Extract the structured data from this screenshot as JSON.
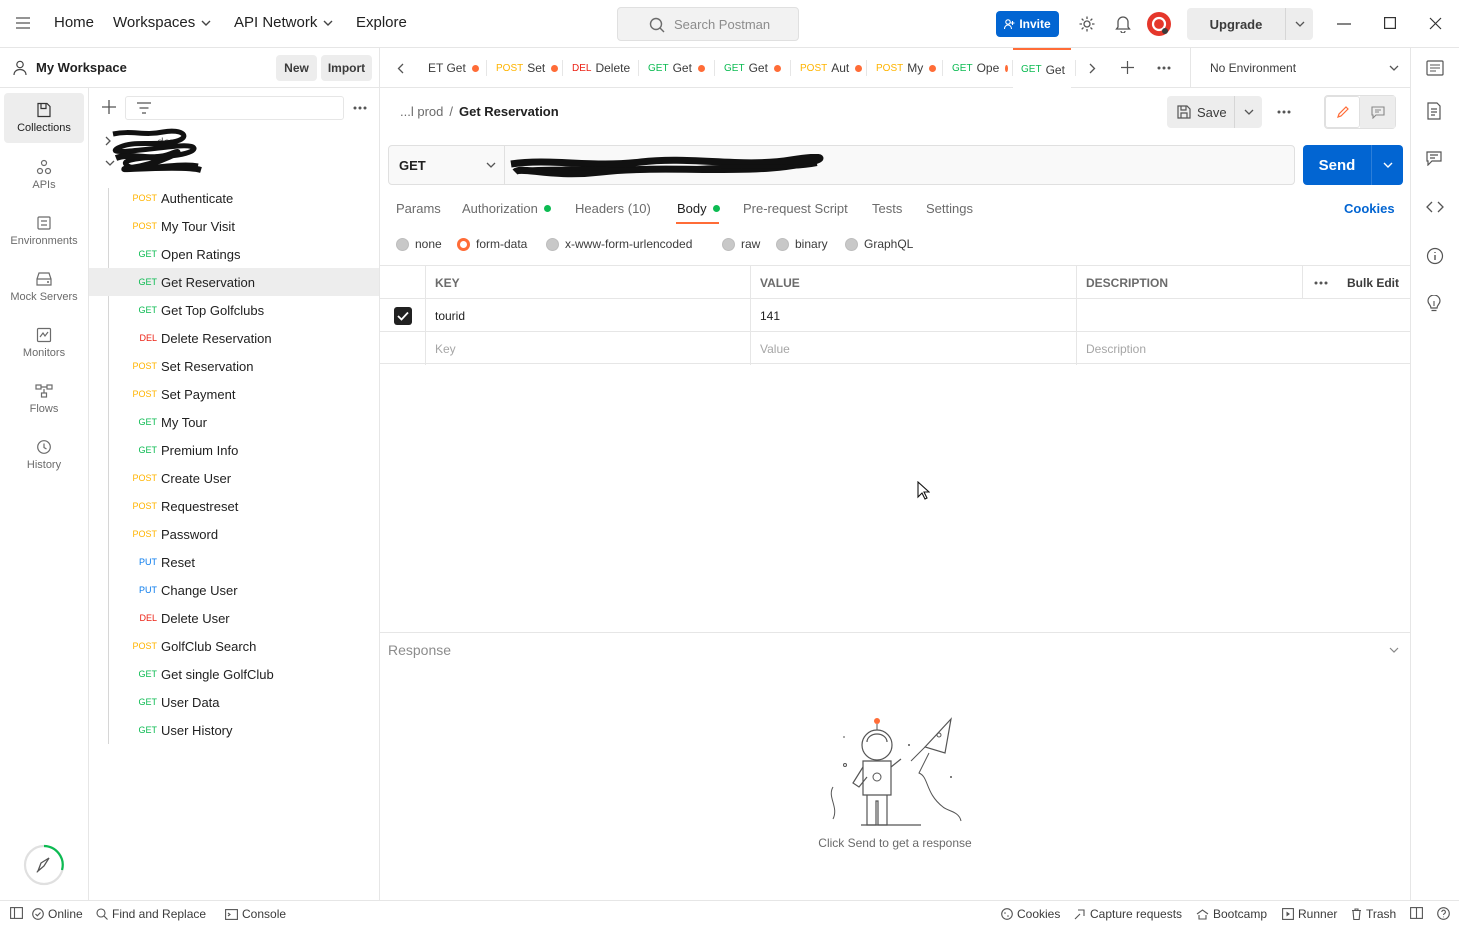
{
  "topbar": {
    "nav": [
      "Home",
      "Workspaces",
      "API Network",
      "Explore"
    ],
    "search_placeholder": "Search Postman",
    "invite_label": "Invite",
    "upgrade_label": "Upgrade"
  },
  "workspace": {
    "title": "My Workspace",
    "new_label": "New",
    "import_label": "Import"
  },
  "rail": [
    {
      "label": "Collections",
      "icon": "collections-icon",
      "active": true
    },
    {
      "label": "APIs",
      "icon": "apis-icon",
      "active": false
    },
    {
      "label": "Environments",
      "icon": "environments-icon",
      "active": false
    },
    {
      "label": "Mock Servers",
      "icon": "mock-servers-icon",
      "active": false
    },
    {
      "label": "Monitors",
      "icon": "monitors-icon",
      "active": false
    },
    {
      "label": "Flows",
      "icon": "flows-icon",
      "active": false
    },
    {
      "label": "History",
      "icon": "history-icon",
      "active": false
    }
  ],
  "tree": {
    "collection_partial": "dev",
    "items": [
      {
        "method": "POST",
        "name": "Authenticate"
      },
      {
        "method": "POST",
        "name": "My Tour Visit"
      },
      {
        "method": "GET",
        "name": "Open Ratings"
      },
      {
        "method": "GET",
        "name": "Get Reservation",
        "selected": true
      },
      {
        "method": "GET",
        "name": "Get Top Golfclubs"
      },
      {
        "method": "DEL",
        "name": "Delete Reservation"
      },
      {
        "method": "POST",
        "name": "Set Reservation"
      },
      {
        "method": "POST",
        "name": "Set Payment"
      },
      {
        "method": "GET",
        "name": "My Tour"
      },
      {
        "method": "GET",
        "name": "Premium Info"
      },
      {
        "method": "POST",
        "name": "Create User"
      },
      {
        "method": "POST",
        "name": "Requestreset"
      },
      {
        "method": "POST",
        "name": "Password"
      },
      {
        "method": "PUT",
        "name": "Reset"
      },
      {
        "method": "PUT",
        "name": "Change User"
      },
      {
        "method": "DEL",
        "name": "Delete User"
      },
      {
        "method": "POST",
        "name": "GolfClub Search"
      },
      {
        "method": "GET",
        "name": "Get single GolfClub"
      },
      {
        "method": "GET",
        "name": "User Data"
      },
      {
        "method": "GET",
        "name": "User History"
      }
    ]
  },
  "tabs": [
    {
      "method": "",
      "name": "ET Get",
      "dot": true
    },
    {
      "method": "POST",
      "name": "Set",
      "dot": true
    },
    {
      "method": "DEL",
      "name": "Delete",
      "dot": false
    },
    {
      "method": "GET",
      "name": "Get",
      "dot": true
    },
    {
      "method": "GET",
      "name": "Get",
      "dot": true
    },
    {
      "method": "POST",
      "name": "Aut",
      "dot": true
    },
    {
      "method": "POST",
      "name": "My",
      "dot": true
    },
    {
      "method": "GET",
      "name": "Ope",
      "dot": true
    },
    {
      "method": "GET",
      "name": "Get",
      "dot": true,
      "active": true
    }
  ],
  "environment": {
    "label": "No Environment"
  },
  "breadcrumb": {
    "parent": "...l prod",
    "separator": "/",
    "current": "Get Reservation"
  },
  "save_label": "Save",
  "request": {
    "method": "GET",
    "send_label": "Send",
    "tabs": [
      {
        "label": "Params",
        "dot": false
      },
      {
        "label": "Authorization",
        "dot": true
      },
      {
        "label": "Headers (10)",
        "dot": false
      },
      {
        "label": "Body",
        "dot": true,
        "active": true
      },
      {
        "label": "Pre-request Script",
        "dot": false
      },
      {
        "label": "Tests",
        "dot": false
      },
      {
        "label": "Settings",
        "dot": false
      }
    ],
    "cookies_label": "Cookies",
    "body_types": [
      {
        "label": "none",
        "selected": false
      },
      {
        "label": "form-data",
        "selected": true
      },
      {
        "label": "x-www-form-urlencoded",
        "selected": false
      },
      {
        "label": "raw",
        "selected": false
      },
      {
        "label": "binary",
        "selected": false
      },
      {
        "label": "GraphQL",
        "selected": false
      }
    ]
  },
  "form_table": {
    "headers": {
      "key": "KEY",
      "value": "VALUE",
      "description": "DESCRIPTION",
      "bulk_edit": "Bulk Edit"
    },
    "rows": [
      {
        "checked": true,
        "key": "tourid",
        "value": "141",
        "description": ""
      }
    ],
    "placeholders": {
      "key": "Key",
      "value": "Value",
      "description": "Description"
    }
  },
  "response": {
    "title": "Response",
    "hint": "Click Send to get a response"
  },
  "statusbar": {
    "online": "Online",
    "find_replace": "Find and Replace",
    "console": "Console",
    "cookies": "Cookies",
    "capture": "Capture requests",
    "bootcamp": "Bootcamp",
    "runner": "Runner",
    "trash": "Trash"
  },
  "colors": {
    "accent": "#ff6c37",
    "primary": "#0265d2",
    "get": "#0cbb52",
    "post": "#ffb400",
    "put": "#097bed",
    "delete": "#eb2013"
  }
}
